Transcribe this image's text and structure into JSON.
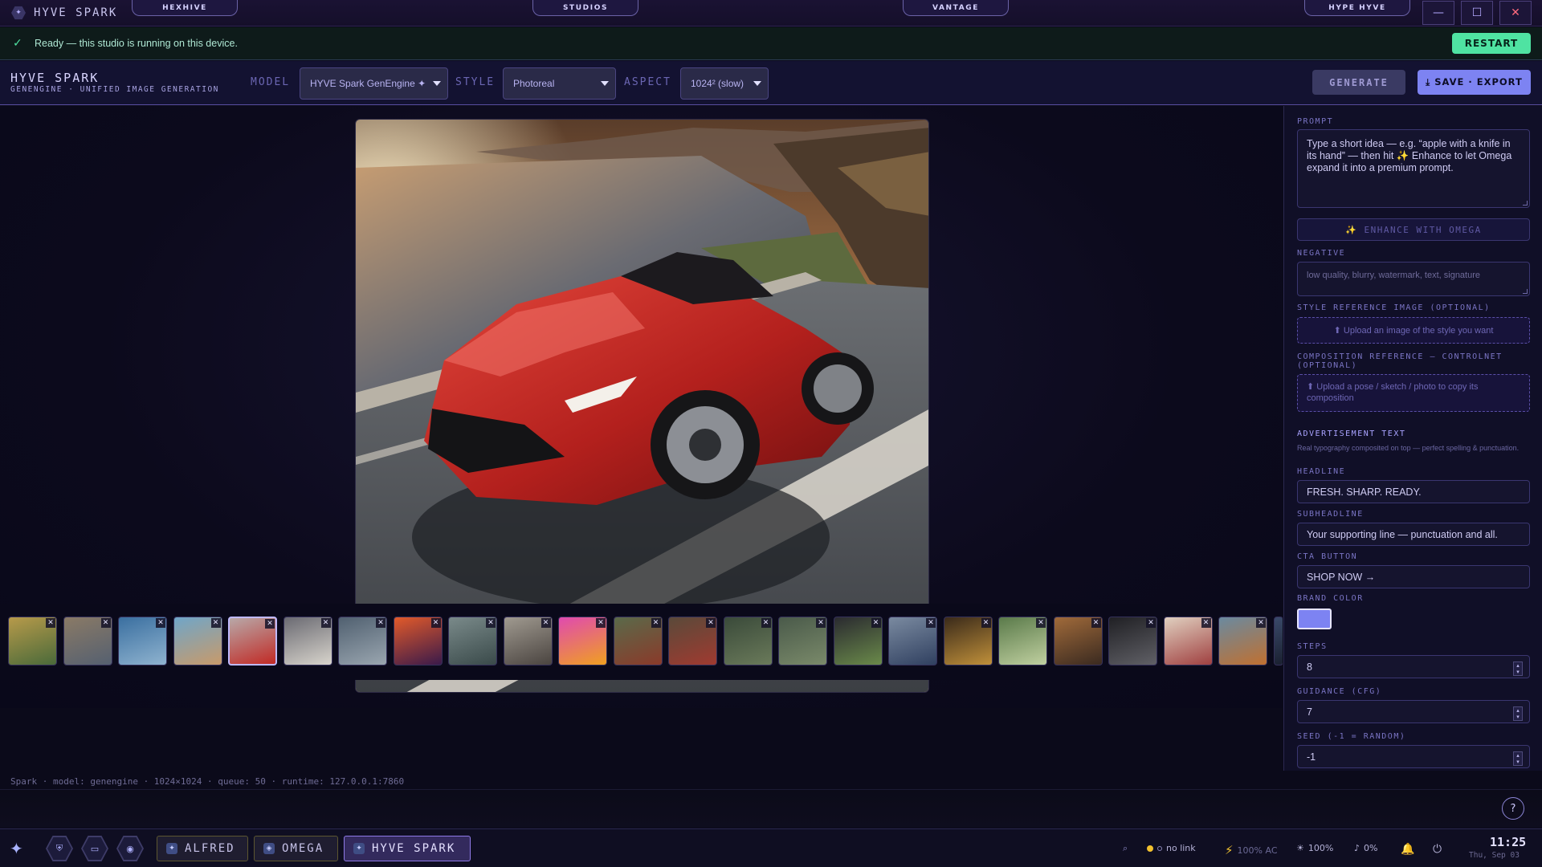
{
  "window": {
    "app_name": "HYVE SPARK",
    "nav_tabs": [
      "HEXHIVE",
      "STUDIOS",
      "VANTAGE",
      "HYPE HYVE"
    ],
    "minimize": "—",
    "maximize": "☐",
    "close": "✕"
  },
  "status": {
    "icon": "✓",
    "message": "Ready — this studio is running on this device.",
    "restart_label": "RESTART"
  },
  "toolbar": {
    "title": "HYVE SPARK",
    "subtitle": "GENENGINE · UNIFIED IMAGE GENERATION",
    "model_label": "MODEL",
    "model_value": "HYVE Spark GenEngine ✦",
    "style_label": "STYLE",
    "style_value": "Photoreal",
    "aspect_label": "ASPECT",
    "aspect_value": "1024² (slow)",
    "generate_label": "GENERATE",
    "save_label": "⤓ SAVE · EXPORT"
  },
  "preview": {
    "description_icon": "generated-image"
  },
  "thumbnails": {
    "close_glyph": "✕",
    "count": 23,
    "active_index": 4
  },
  "footer": {
    "text": "Spark · model: genengine · 1024×1024 · queue: 50 · runtime: 127.0.0.1:7860"
  },
  "panel": {
    "prompt_label": "PROMPT",
    "prompt_placeholder": "Type a short idea — e.g. “apple with a knife in its hand” — then hit ✨ Enhance to let Omega expand it into a premium prompt.",
    "enhance_label": "✨ ENHANCE WITH OMEGA",
    "negative_label": "NEGATIVE",
    "negative_placeholder": "low quality, blurry, watermark, text, signature",
    "style_ref_label": "STYLE REFERENCE IMAGE (OPTIONAL)",
    "style_ref_upload": "⬆ Upload an image of the style you want",
    "comp_ref_label": "COMPOSITION REFERENCE — CONTROLNET (OPTIONAL)",
    "comp_ref_upload": "⬆ Upload a pose / sketch / photo to copy its composition",
    "ad_label": "ADVERTISEMENT TEXT",
    "ad_sub": "Real typography composited on top — perfect spelling & punctuation.",
    "headline_label": "HEADLINE",
    "headline_value": "FRESH. SHARP. READY.",
    "subheadline_label": "SUBHEADLINE",
    "subheadline_value": "Your supporting line — punctuation and all.",
    "cta_label": "CTA BUTTON",
    "cta_value": "SHOP NOW →",
    "brand_color_label": "BRAND COLOR",
    "brand_color": "#7d83f2",
    "steps_label": "STEPS",
    "steps_value": "8",
    "guidance_label": "GUIDANCE (CFG)",
    "guidance_value": "7",
    "seed_label": "SEED (-1 = RANDOM)",
    "seed_value": "-1"
  },
  "help": {
    "label": "?"
  },
  "taskbar": {
    "apps": [
      "ALFRED",
      "OMEGA",
      "HYVE SPARK"
    ],
    "tray_search": "⌕",
    "link_status": "no link",
    "power": "100% AC",
    "brightness": "100%",
    "volume": "0%",
    "time": "11:25",
    "date": "Thu, Sep 03"
  }
}
